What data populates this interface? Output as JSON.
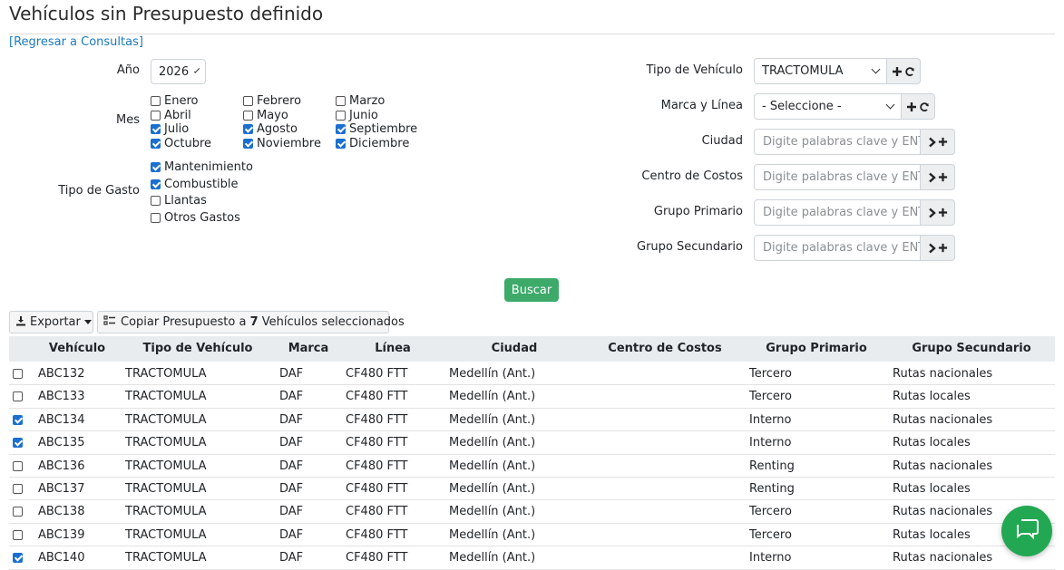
{
  "page": {
    "title": "Vehículos sin Presupuesto definido",
    "back_link": "[Regresar a Consultas]"
  },
  "filters": {
    "anio": {
      "label": "Año",
      "value": "2026"
    },
    "mes": {
      "label": "Mes",
      "months": [
        {
          "label": "Enero",
          "checked": false
        },
        {
          "label": "Febrero",
          "checked": false
        },
        {
          "label": "Marzo",
          "checked": false
        },
        {
          "label": "Abril",
          "checked": false
        },
        {
          "label": "Mayo",
          "checked": false
        },
        {
          "label": "Junio",
          "checked": false
        },
        {
          "label": "Julio",
          "checked": true
        },
        {
          "label": "Agosto",
          "checked": true
        },
        {
          "label": "Septiembre",
          "checked": true
        },
        {
          "label": "Octubre",
          "checked": true
        },
        {
          "label": "Noviembre",
          "checked": true
        },
        {
          "label": "Diciembre",
          "checked": true
        }
      ]
    },
    "tipo_gasto": {
      "label": "Tipo de Gasto",
      "options": [
        {
          "label": "Mantenimiento",
          "checked": true
        },
        {
          "label": "Combustible",
          "checked": true
        },
        {
          "label": "Llantas",
          "checked": false
        },
        {
          "label": "Otros Gastos",
          "checked": false
        }
      ]
    },
    "tipo_vehiculo": {
      "label": "Tipo de Vehículo",
      "value": "TRACTOMULA"
    },
    "marca_linea": {
      "label": "Marca y Línea",
      "value": "- Seleccione -"
    },
    "ciudad": {
      "label": "Ciudad",
      "placeholder": "Digite palabras clave y ENTER"
    },
    "centro_costos": {
      "label": "Centro de Costos",
      "placeholder": "Digite palabras clave y ENTER"
    },
    "grupo_primario": {
      "label": "Grupo Primario",
      "placeholder": "Digite palabras clave y ENTER"
    },
    "grupo_secundario": {
      "label": "Grupo Secundario",
      "placeholder": "Digite palabras clave y ENTER"
    },
    "buscar_label": "Buscar"
  },
  "toolbar": {
    "exportar_label": "Exportar",
    "copiar_prefix": "Copiar Presupuesto a ",
    "copiar_count": "7",
    "copiar_suffix": " Vehículos seleccionados"
  },
  "table": {
    "columns": [
      "Vehículo",
      "Tipo de Vehículo",
      "Marca",
      "Línea",
      "Ciudad",
      "Centro de Costos",
      "Grupo Primario",
      "Grupo Secundario"
    ],
    "rows": [
      {
        "checked": false,
        "vehiculo": "ABC132",
        "tipo": "TRACTOMULA",
        "marca": "DAF",
        "linea": "CF480 FTT",
        "ciudad": "Medellín (Ant.)",
        "centro": "",
        "primario": "Tercero",
        "secundario": "Rutas nacionales"
      },
      {
        "checked": false,
        "vehiculo": "ABC133",
        "tipo": "TRACTOMULA",
        "marca": "DAF",
        "linea": "CF480 FTT",
        "ciudad": "Medellín (Ant.)",
        "centro": "",
        "primario": "Tercero",
        "secundario": "Rutas locales"
      },
      {
        "checked": true,
        "vehiculo": "ABC134",
        "tipo": "TRACTOMULA",
        "marca": "DAF",
        "linea": "CF480 FTT",
        "ciudad": "Medellín (Ant.)",
        "centro": "",
        "primario": "Interno",
        "secundario": "Rutas nacionales"
      },
      {
        "checked": true,
        "vehiculo": "ABC135",
        "tipo": "TRACTOMULA",
        "marca": "DAF",
        "linea": "CF480 FTT",
        "ciudad": "Medellín (Ant.)",
        "centro": "",
        "primario": "Interno",
        "secundario": "Rutas locales"
      },
      {
        "checked": false,
        "vehiculo": "ABC136",
        "tipo": "TRACTOMULA",
        "marca": "DAF",
        "linea": "CF480 FTT",
        "ciudad": "Medellín (Ant.)",
        "centro": "",
        "primario": "Renting",
        "secundario": "Rutas nacionales"
      },
      {
        "checked": false,
        "vehiculo": "ABC137",
        "tipo": "TRACTOMULA",
        "marca": "DAF",
        "linea": "CF480 FTT",
        "ciudad": "Medellín (Ant.)",
        "centro": "",
        "primario": "Renting",
        "secundario": "Rutas locales"
      },
      {
        "checked": false,
        "vehiculo": "ABC138",
        "tipo": "TRACTOMULA",
        "marca": "DAF",
        "linea": "CF480 FTT",
        "ciudad": "Medellín (Ant.)",
        "centro": "",
        "primario": "Tercero",
        "secundario": "Rutas nacionales"
      },
      {
        "checked": false,
        "vehiculo": "ABC139",
        "tipo": "TRACTOMULA",
        "marca": "DAF",
        "linea": "CF480 FTT",
        "ciudad": "Medellín (Ant.)",
        "centro": "",
        "primario": "Tercero",
        "secundario": "Rutas locales"
      },
      {
        "checked": true,
        "vehiculo": "ABC140",
        "tipo": "TRACTOMULA",
        "marca": "DAF",
        "linea": "CF480 FTT",
        "ciudad": "Medellín (Ant.)",
        "centro": "",
        "primario": "Interno",
        "secundario": "Rutas nacionales"
      }
    ]
  },
  "colors": {
    "accent": "#1a6fd1",
    "buscar": "#3daa6a",
    "chat": "#22a852",
    "link": "#1a7bbf"
  }
}
